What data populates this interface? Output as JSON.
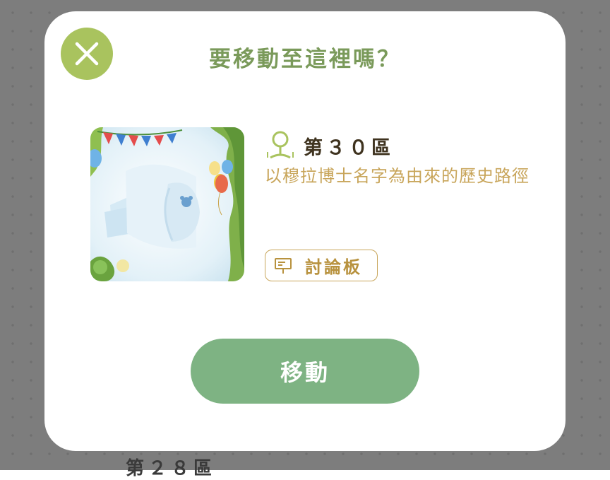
{
  "background": {
    "peek_label": "第２８區"
  },
  "dialog": {
    "title": "要移動至這裡嗎？",
    "close_icon": "close-icon",
    "zone": {
      "name": "第３０區",
      "icon": "landmark-sign-icon",
      "description": "以穆拉博士名字為由來的歷史路徑"
    },
    "forum_button": {
      "icon": "signboard-icon",
      "label": "討論板"
    },
    "move_button": {
      "label": "移動"
    }
  },
  "colors": {
    "title": "#7a9a5a",
    "close_button": "#a9c35e",
    "gold": "#c8a55a",
    "move_button": "#7eb383",
    "overlay": "#7d7d7d"
  }
}
